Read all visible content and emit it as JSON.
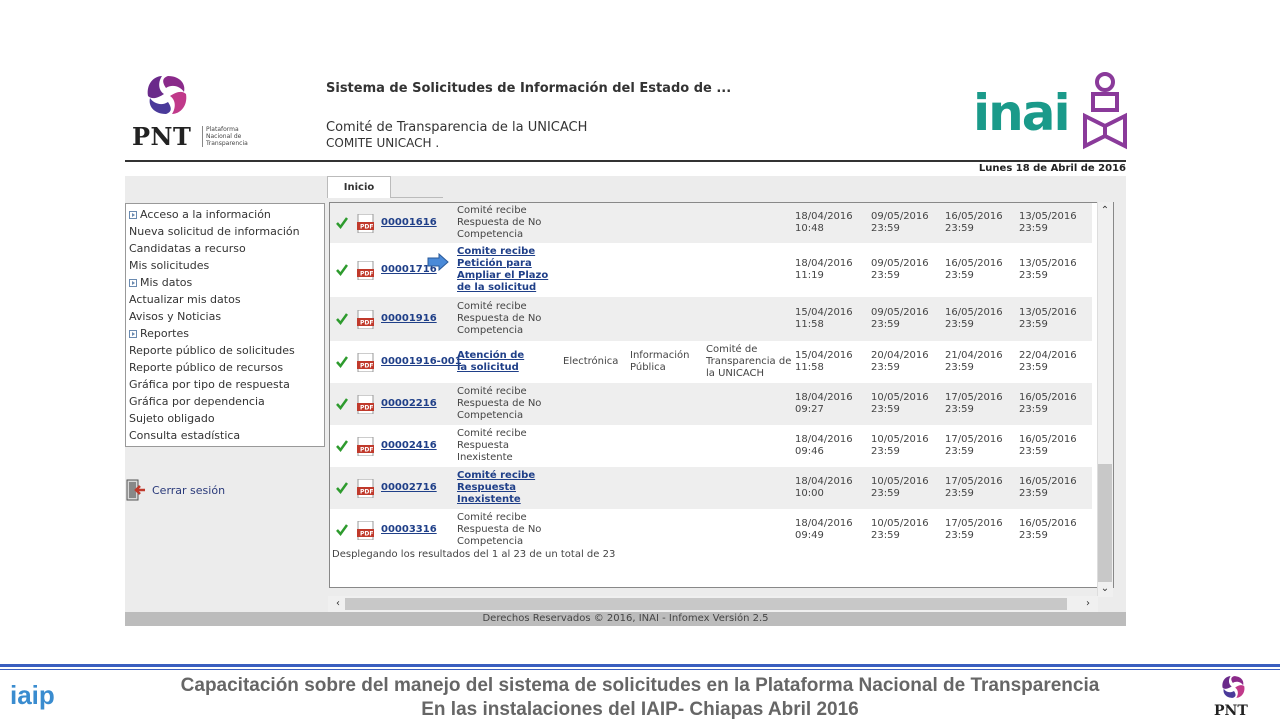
{
  "header": {
    "pnt_logo_text": "PNT",
    "pnt_logo_sub": "Plataforma Nacional de Transparencia",
    "system_title": "Sistema de Solicitudes de Información del Estado de ...",
    "comite_name": "Comité de Transparencia de la UNICACH",
    "comite_sub": "COMITE UNICACH .",
    "inai_logo_text": "inai",
    "date": "Lunes 18 de Abril de 2016"
  },
  "tabs": [
    {
      "label": "Inicio",
      "active": true
    }
  ],
  "sidebar": {
    "items": [
      {
        "label": "Acceso a la información",
        "section": true
      },
      {
        "label": "Nueva solicitud de información",
        "section": false
      },
      {
        "label": "Candidatas a recurso",
        "section": false
      },
      {
        "label": "Mis solicitudes",
        "section": false
      },
      {
        "label": "Mis datos",
        "section": true
      },
      {
        "label": "Actualizar mis datos",
        "section": false
      },
      {
        "label": "Avisos y Noticias",
        "section": false
      },
      {
        "label": "Reportes",
        "section": true
      },
      {
        "label": "Reporte público de solicitudes",
        "section": false
      },
      {
        "label": "Reporte público de recursos",
        "section": false
      },
      {
        "label": "Gráfica por tipo de respuesta",
        "section": false
      },
      {
        "label": "Gráfica por dependencia",
        "section": false
      },
      {
        "label": "Sujeto obligado",
        "section": false
      },
      {
        "label": "Consulta estadística",
        "section": false
      }
    ],
    "logout_label": "Cerrar sesión"
  },
  "table": {
    "rows": [
      {
        "folio": "00001616",
        "description": "Comité recibe Respuesta de No Competencia",
        "desc_link": false,
        "medio": "",
        "tipo": "",
        "dependencia": "",
        "dates": [
          "18/04/2016 10:48",
          "09/05/2016 23:59",
          "16/05/2016 23:59",
          "13/05/2016 23:59"
        ]
      },
      {
        "folio": "00001716",
        "description": "Comite recibe Petición para Ampliar el Plazo de la solicitud",
        "desc_link": true,
        "medio": "",
        "tipo": "",
        "dependencia": "",
        "dates": [
          "18/04/2016 11:19",
          "09/05/2016 23:59",
          "16/05/2016 23:59",
          "13/05/2016 23:59"
        ]
      },
      {
        "folio": "00001916",
        "description": "Comité recibe Respuesta de No Competencia",
        "desc_link": false,
        "medio": "",
        "tipo": "",
        "dependencia": "",
        "dates": [
          "15/04/2016 11:58",
          "09/05/2016 23:59",
          "16/05/2016 23:59",
          "13/05/2016 23:59"
        ]
      },
      {
        "folio": "00001916-001",
        "description": "Atención de la solicitud",
        "desc_link": true,
        "medio": "Electrónica",
        "tipo": "Información Pública",
        "dependencia": "Comité de Transparencia de la UNICACH",
        "dates": [
          "15/04/2016 11:58",
          "20/04/2016 23:59",
          "21/04/2016 23:59",
          "22/04/2016 23:59"
        ]
      },
      {
        "folio": "00002216",
        "description": "Comité recibe Respuesta de No Competencia",
        "desc_link": false,
        "medio": "",
        "tipo": "",
        "dependencia": "",
        "dates": [
          "18/04/2016 09:27",
          "10/05/2016 23:59",
          "17/05/2016 23:59",
          "16/05/2016 23:59"
        ]
      },
      {
        "folio": "00002416",
        "description": "Comité recibe Respuesta Inexistente",
        "desc_link": false,
        "medio": "",
        "tipo": "",
        "dependencia": "",
        "dates": [
          "18/04/2016 09:46",
          "10/05/2016 23:59",
          "17/05/2016 23:59",
          "16/05/2016 23:59"
        ]
      },
      {
        "folio": "00002716",
        "description": "Comité recibe Respuesta Inexistente",
        "desc_link": true,
        "medio": "",
        "tipo": "",
        "dependencia": "",
        "dates": [
          "18/04/2016 10:00",
          "10/05/2016 23:59",
          "17/05/2016 23:59",
          "16/05/2016 23:59"
        ]
      },
      {
        "folio": "00003316",
        "description": "Comité recibe Respuesta de No Competencia",
        "desc_link": false,
        "medio": "",
        "tipo": "",
        "dependencia": "",
        "dates": [
          "18/04/2016 09:49",
          "10/05/2016 23:59",
          "17/05/2016 23:59",
          "16/05/2016 23:59"
        ]
      }
    ],
    "results_text": "Desplegando los resultados del 1 al 23 de un total de 23"
  },
  "footer": {
    "copyright": "Derechos Reservados © 2016, INAI - Infomex Versión 2.5"
  },
  "caption": {
    "line1": "Capacitación sobre del manejo del sistema de solicitudes en la Plataforma Nacional de Transparencia",
    "line2": "En las instalaciones del IAIP- Chiapas    Abril 2016",
    "iaip_logo_text": "iaip",
    "pnt_logo_text": "PNT"
  },
  "colors": {
    "link": "#1f3f88",
    "check": "#2e9b2e",
    "pdf": "#c0392b",
    "inai_teal": "#1a9a8a",
    "inai_purple": "#8a3a9a",
    "caption_rule": "#3a5fbf"
  }
}
